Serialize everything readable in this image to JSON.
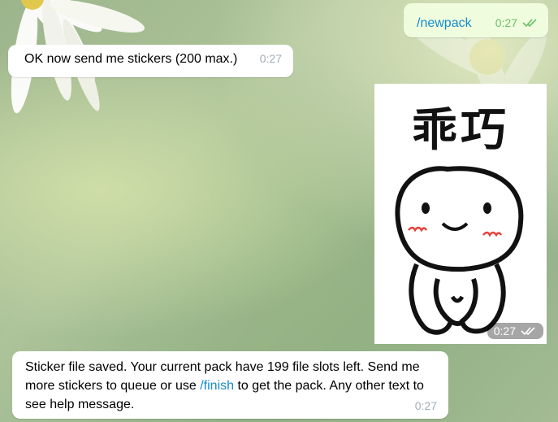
{
  "messages": [
    {
      "id": "newpack",
      "direction": "outgoing",
      "text": "/newpack",
      "time": "0:27",
      "status_icon": "double-check-icon"
    },
    {
      "id": "ok-send",
      "direction": "incoming",
      "text": "OK now send me stickers (200 max.)",
      "time": "0:27"
    },
    {
      "id": "sticker",
      "direction": "outgoing",
      "type": "sticker",
      "sticker_text": "乖巧",
      "time": "0:27",
      "status_icon": "double-check-icon"
    },
    {
      "id": "saved",
      "direction": "incoming",
      "text_before": "Sticker file saved. Your current pack have 199 file slots left. Send me more stickers to queue or use ",
      "command": "/finish",
      "text_after": " to get the pack. Any other text to see help message.",
      "time": "0:27"
    }
  ],
  "colors": {
    "incoming_bubble": "#ffffff",
    "outgoing_bubble": "#effdde",
    "link": "#168acd",
    "outgoing_time": "#6cbf67",
    "incoming_time": "#a0acb6"
  }
}
